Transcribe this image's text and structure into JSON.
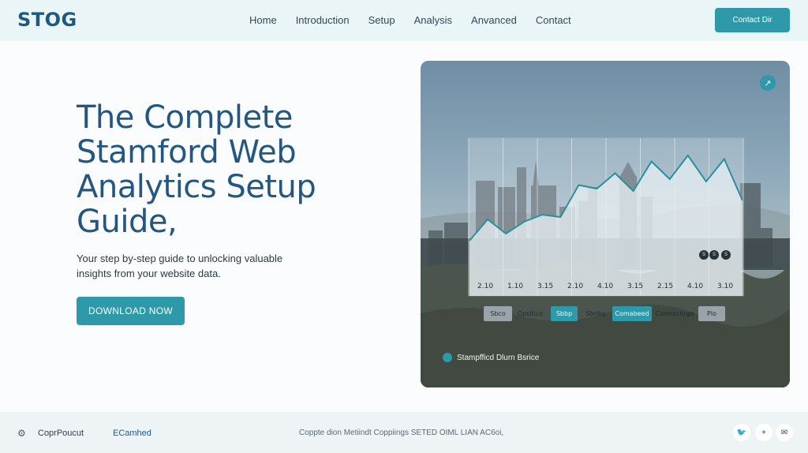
{
  "header": {
    "logo": "STOG",
    "nav": [
      "Home",
      "Introduction",
      "Setup",
      "Analysis",
      "Anvanced",
      "Contact"
    ],
    "contact_button": "Contact Dir"
  },
  "hero": {
    "title": "The Complete Stamford Web Analytics Setup Guide,",
    "subtitle": "Your step by-step guide to unlocking valuable insights from your website data.",
    "cta": "DOWNLOAD NOW"
  },
  "panel": {
    "corner_icon": "arrow-icon",
    "legend_dots": [
      "S",
      "S",
      "S"
    ],
    "pills": [
      "Sbco",
      "Opsitico",
      "Sbbp",
      "Sbrlby",
      "Comabeed",
      "Comsschrge",
      "Plo"
    ],
    "caption": "Stampfficd Dlurn Bsrice",
    "chart_data": {
      "type": "area",
      "categories": [
        "2.10",
        "1.10",
        "3.15",
        "2.10",
        "4.10",
        "3.15",
        "2.15",
        "4.10",
        "3.10"
      ],
      "values": [
        28,
        46,
        34,
        44,
        50,
        48,
        75,
        72,
        85,
        70,
        95,
        80,
        100,
        78,
        97,
        62
      ],
      "title": "",
      "xlabel": "",
      "ylabel": "",
      "grid": true,
      "colors": {
        "line": "#2b8f9d",
        "fill": "#dfe9ee"
      }
    }
  },
  "footer": {
    "product": "CoprPoucut",
    "link": "ECamhed",
    "copyright": "Coppte dion Metiindt Coppiings SETED OIML LIAN AC6oi,",
    "social": [
      "twitter-icon",
      "plus-icon",
      "mail-icon"
    ]
  },
  "colors": {
    "accent": "#2e9aa9",
    "title": "#235781",
    "header_bg": "#e9f5f7"
  }
}
